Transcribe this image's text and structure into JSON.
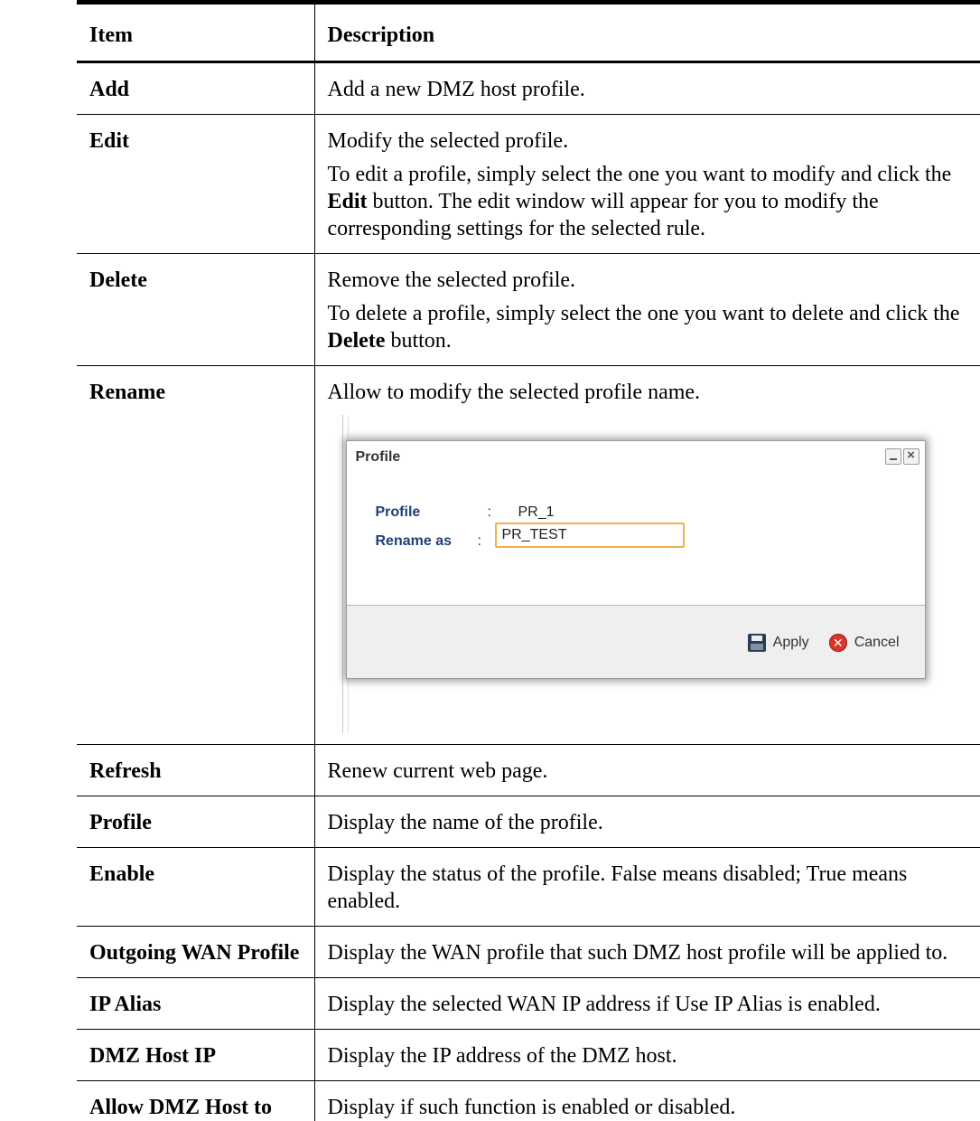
{
  "table": {
    "headers": [
      "Item",
      "Description"
    ],
    "rows": [
      {
        "item": "Add",
        "desc": "Add a new DMZ host profile."
      },
      {
        "item": "Edit",
        "desc": "Modify the selected profile.",
        "note_pre": "To edit a profile, simply select the one you want to modify and click the ",
        "note_bold": "Edit",
        "note_post": " button. The edit window will appear for you to modify the corresponding settings for the selected rule."
      },
      {
        "item": "Delete",
        "desc": "Remove the selected profile.",
        "note_pre": "To delete a profile, simply select the one you want to delete and click the ",
        "note_bold": "Delete",
        "note_post": " button."
      },
      {
        "item": "Rename",
        "desc": "Allow to modify the selected profile name."
      },
      {
        "item": "Refresh",
        "desc": "Renew current web page."
      },
      {
        "item": "Profile",
        "desc": "Display the name of the profile."
      },
      {
        "item": "Enable",
        "desc": "Display the status of the profile. False means disabled; True means enabled."
      },
      {
        "item": "Outgoing WAN Profile",
        "desc": "Display the WAN profile that such DMZ host profile will be applied to."
      },
      {
        "item": "IP Alias",
        "desc": "Display the selected WAN IP address if Use IP Alias is enabled."
      },
      {
        "item": "DMZ Host IP",
        "desc": "Display the IP address of the DMZ host."
      },
      {
        "item": "Allow DMZ Host to",
        "desc": "Display if such function is enabled or disabled."
      }
    ]
  },
  "dialog": {
    "title": "Profile",
    "profile_label": "Profile",
    "profile_colon": ":",
    "profile_value": "PR_1",
    "rename_label": "Rename as",
    "rename_colon": ":",
    "rename_value": "PR_TEST",
    "apply_label": "Apply",
    "cancel_label": "Cancel",
    "icons": {
      "minimize": "minimize-icon",
      "close": "close-icon",
      "apply": "save-icon",
      "cancel": "cancel-icon"
    },
    "colors": {
      "label": "#1f3f7a",
      "input_border": "#f0b050",
      "cancel_icon": "#d6362b"
    }
  }
}
